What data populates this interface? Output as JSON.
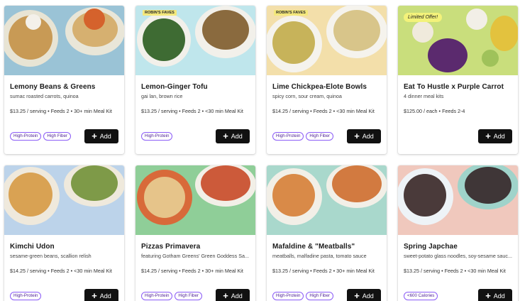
{
  "cards": [
    {
      "title": "Lemony Beans & Greens",
      "subtitle": "sumac roasted carrots, quinoa",
      "meta": "$13.25 / serving • Feeds 2 • 30+ min Meal Kit",
      "tags": [
        "High-Protein",
        "High Fiber"
      ],
      "badge": "",
      "add_label": "Add",
      "bg": "#9ac3d6"
    },
    {
      "title": "Lemon-Ginger Tofu",
      "subtitle": "gai lan, brown rice",
      "meta": "$13.25 / serving • Feeds 2 • <30 min Meal Kit",
      "tags": [
        "High-Protein"
      ],
      "badge": "ROBIN'S FAVES",
      "add_label": "Add",
      "bg": "#bfe6ec"
    },
    {
      "title": "Lime Chickpea-Elote Bowls",
      "subtitle": "spicy corn, sour cream, quinoa",
      "meta": "$14.25 / serving • Feeds 2 • <30 min Meal Kit",
      "tags": [
        "High-Protein",
        "High Fiber"
      ],
      "badge": "ROBIN'S FAVES",
      "add_label": "Add",
      "bg": "#f3dfaa"
    },
    {
      "title": "Eat To Hustle x Purple Carrot",
      "subtitle": "4 dinner meal kits",
      "meta": "$125.00 / each • Feeds 2-4",
      "tags": [],
      "badge": "Limited Offer!",
      "add_label": "Add",
      "bg": "#c9de7c"
    },
    {
      "title": "Kimchi Udon",
      "subtitle": "sesame-green beans, scallion relish",
      "meta": "$14.25 / serving • Feeds 2 • <30 min Meal Kit",
      "tags": [
        "High-Protein"
      ],
      "badge": "",
      "add_label": "Add",
      "bg": "#bcd3ea"
    },
    {
      "title": "Pizzas Primavera",
      "subtitle": "featuring Gotham Greens' Green Goddess Sa...",
      "meta": "$14.25 / serving • Feeds 2 • 30+ min Meal Kit",
      "tags": [
        "High-Protein",
        "High Fiber"
      ],
      "badge": "",
      "add_label": "Add",
      "bg": "#8fce98"
    },
    {
      "title": "Mafaldine & \"Meatballs\"",
      "subtitle": "meatballs, malfadine pasta, tomato sauce",
      "meta": "$13.25 / serving • Feeds 2 • 30+ min Meal Kit",
      "tags": [
        "High-Protein",
        "High Fiber"
      ],
      "badge": "",
      "add_label": "Add",
      "bg": "#a9d8cc"
    },
    {
      "title": "Spring Japchae",
      "subtitle": "sweet-potato glass noodles, soy-sesame sauc...",
      "meta": "$13.25 / serving • Feeds 2 • <30 min Meal Kit",
      "tags": [
        "<600 Calories"
      ],
      "badge": "",
      "add_label": "Add",
      "bg": "#f0c8bd"
    }
  ]
}
